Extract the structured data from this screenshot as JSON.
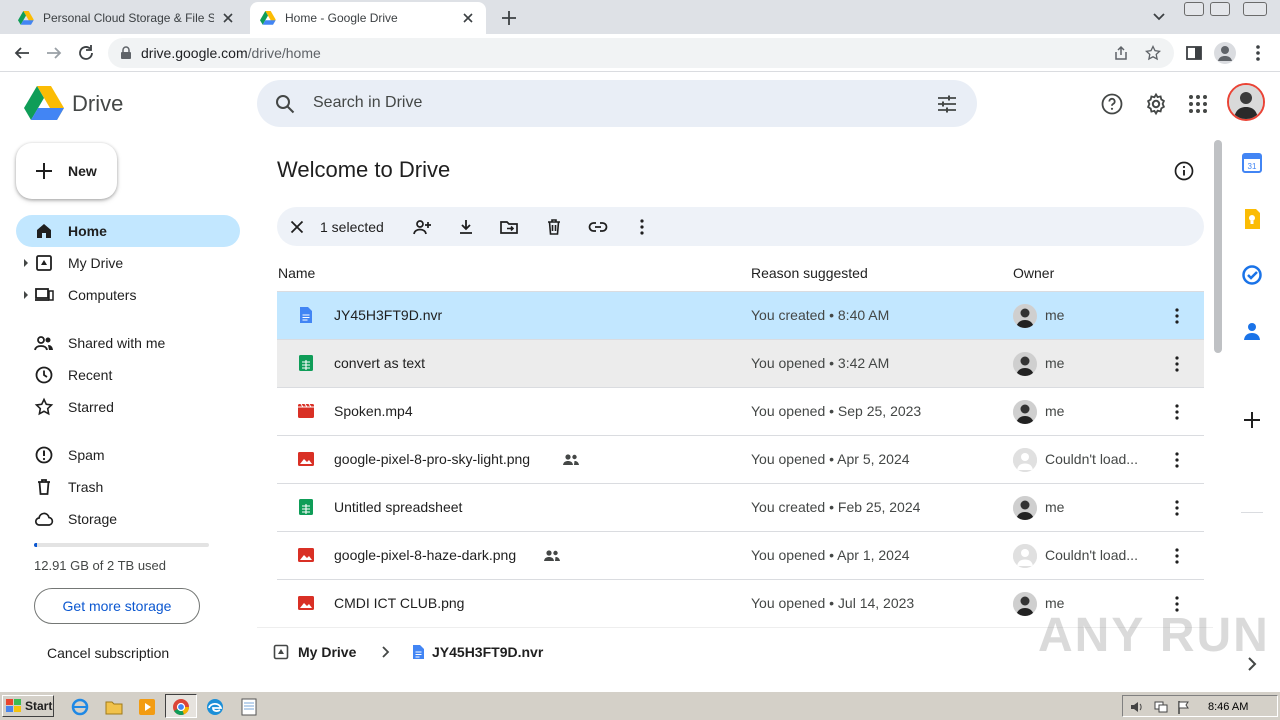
{
  "browser": {
    "tabs": [
      {
        "title": "Personal Cloud Storage & File Sharing",
        "active": false
      },
      {
        "title": "Home - Google Drive",
        "active": true
      }
    ],
    "url_host": "drive.google.com",
    "url_path": "/drive/home"
  },
  "drive": {
    "app_name": "Drive",
    "search_placeholder": "Search in Drive",
    "new_label": "New",
    "nav": [
      {
        "label": "Home",
        "icon": "home-icon",
        "selected": true
      },
      {
        "label": "My Drive",
        "icon": "my-drive-icon",
        "expandable": true
      },
      {
        "label": "Computers",
        "icon": "computers-icon",
        "expandable": true
      },
      {
        "label": "Shared with me",
        "icon": "people-icon"
      },
      {
        "label": "Recent",
        "icon": "clock-icon"
      },
      {
        "label": "Starred",
        "icon": "star-icon"
      },
      {
        "label": "Spam",
        "icon": "spam-icon"
      },
      {
        "label": "Trash",
        "icon": "trash-icon"
      },
      {
        "label": "Storage",
        "icon": "cloud-icon"
      }
    ],
    "storage": {
      "used_text": "12.91 GB of 2 TB used",
      "used_fraction": 0.0063
    },
    "get_more_storage": "Get more storage",
    "cancel_subscription": "Cancel subscription"
  },
  "main": {
    "title": "Welcome to Drive",
    "selection_text": "1 selected",
    "columns": {
      "name": "Name",
      "reason": "Reason suggested",
      "owner": "Owner"
    },
    "files": [
      {
        "name": "JY45H3FT9D.nvr",
        "type": "doc",
        "shared": false,
        "reason": "You created • 8:40 AM",
        "owner": "me",
        "state": "selected"
      },
      {
        "name": "convert as text",
        "type": "sheet",
        "shared": false,
        "reason": "You opened • 3:42 AM",
        "owner": "me",
        "state": "hover"
      },
      {
        "name": "Spoken.mp4",
        "type": "video",
        "shared": false,
        "reason": "You opened • Sep 25, 2023",
        "owner": "me",
        "state": ""
      },
      {
        "name": "google-pixel-8-pro-sky-light.png",
        "type": "image",
        "shared": true,
        "reason": "You opened • Apr 5, 2024",
        "owner": "Couldn't load...",
        "state": ""
      },
      {
        "name": "Untitled spreadsheet",
        "type": "sheet",
        "shared": false,
        "reason": "You created • Feb 25, 2024",
        "owner": "me",
        "state": ""
      },
      {
        "name": "google-pixel-8-haze-dark.png",
        "type": "image",
        "shared": true,
        "reason": "You opened • Apr 1, 2024",
        "owner": "Couldn't load...",
        "state": ""
      },
      {
        "name": "CMDI ICT CLUB.png",
        "type": "image",
        "shared": false,
        "reason": "You opened • Jul 14, 2023",
        "owner": "me",
        "state": ""
      }
    ],
    "breadcrumb": {
      "root": "My Drive",
      "file": "JY45H3FT9D.nvr"
    }
  },
  "watermark": "ANY RUN",
  "taskbar": {
    "start": "Start",
    "clock": "8:46 AM"
  },
  "colors": {
    "selected_row": "#c2e7ff",
    "doc": "#4285f4",
    "sheet": "#0f9d58",
    "red": "#d93025"
  }
}
